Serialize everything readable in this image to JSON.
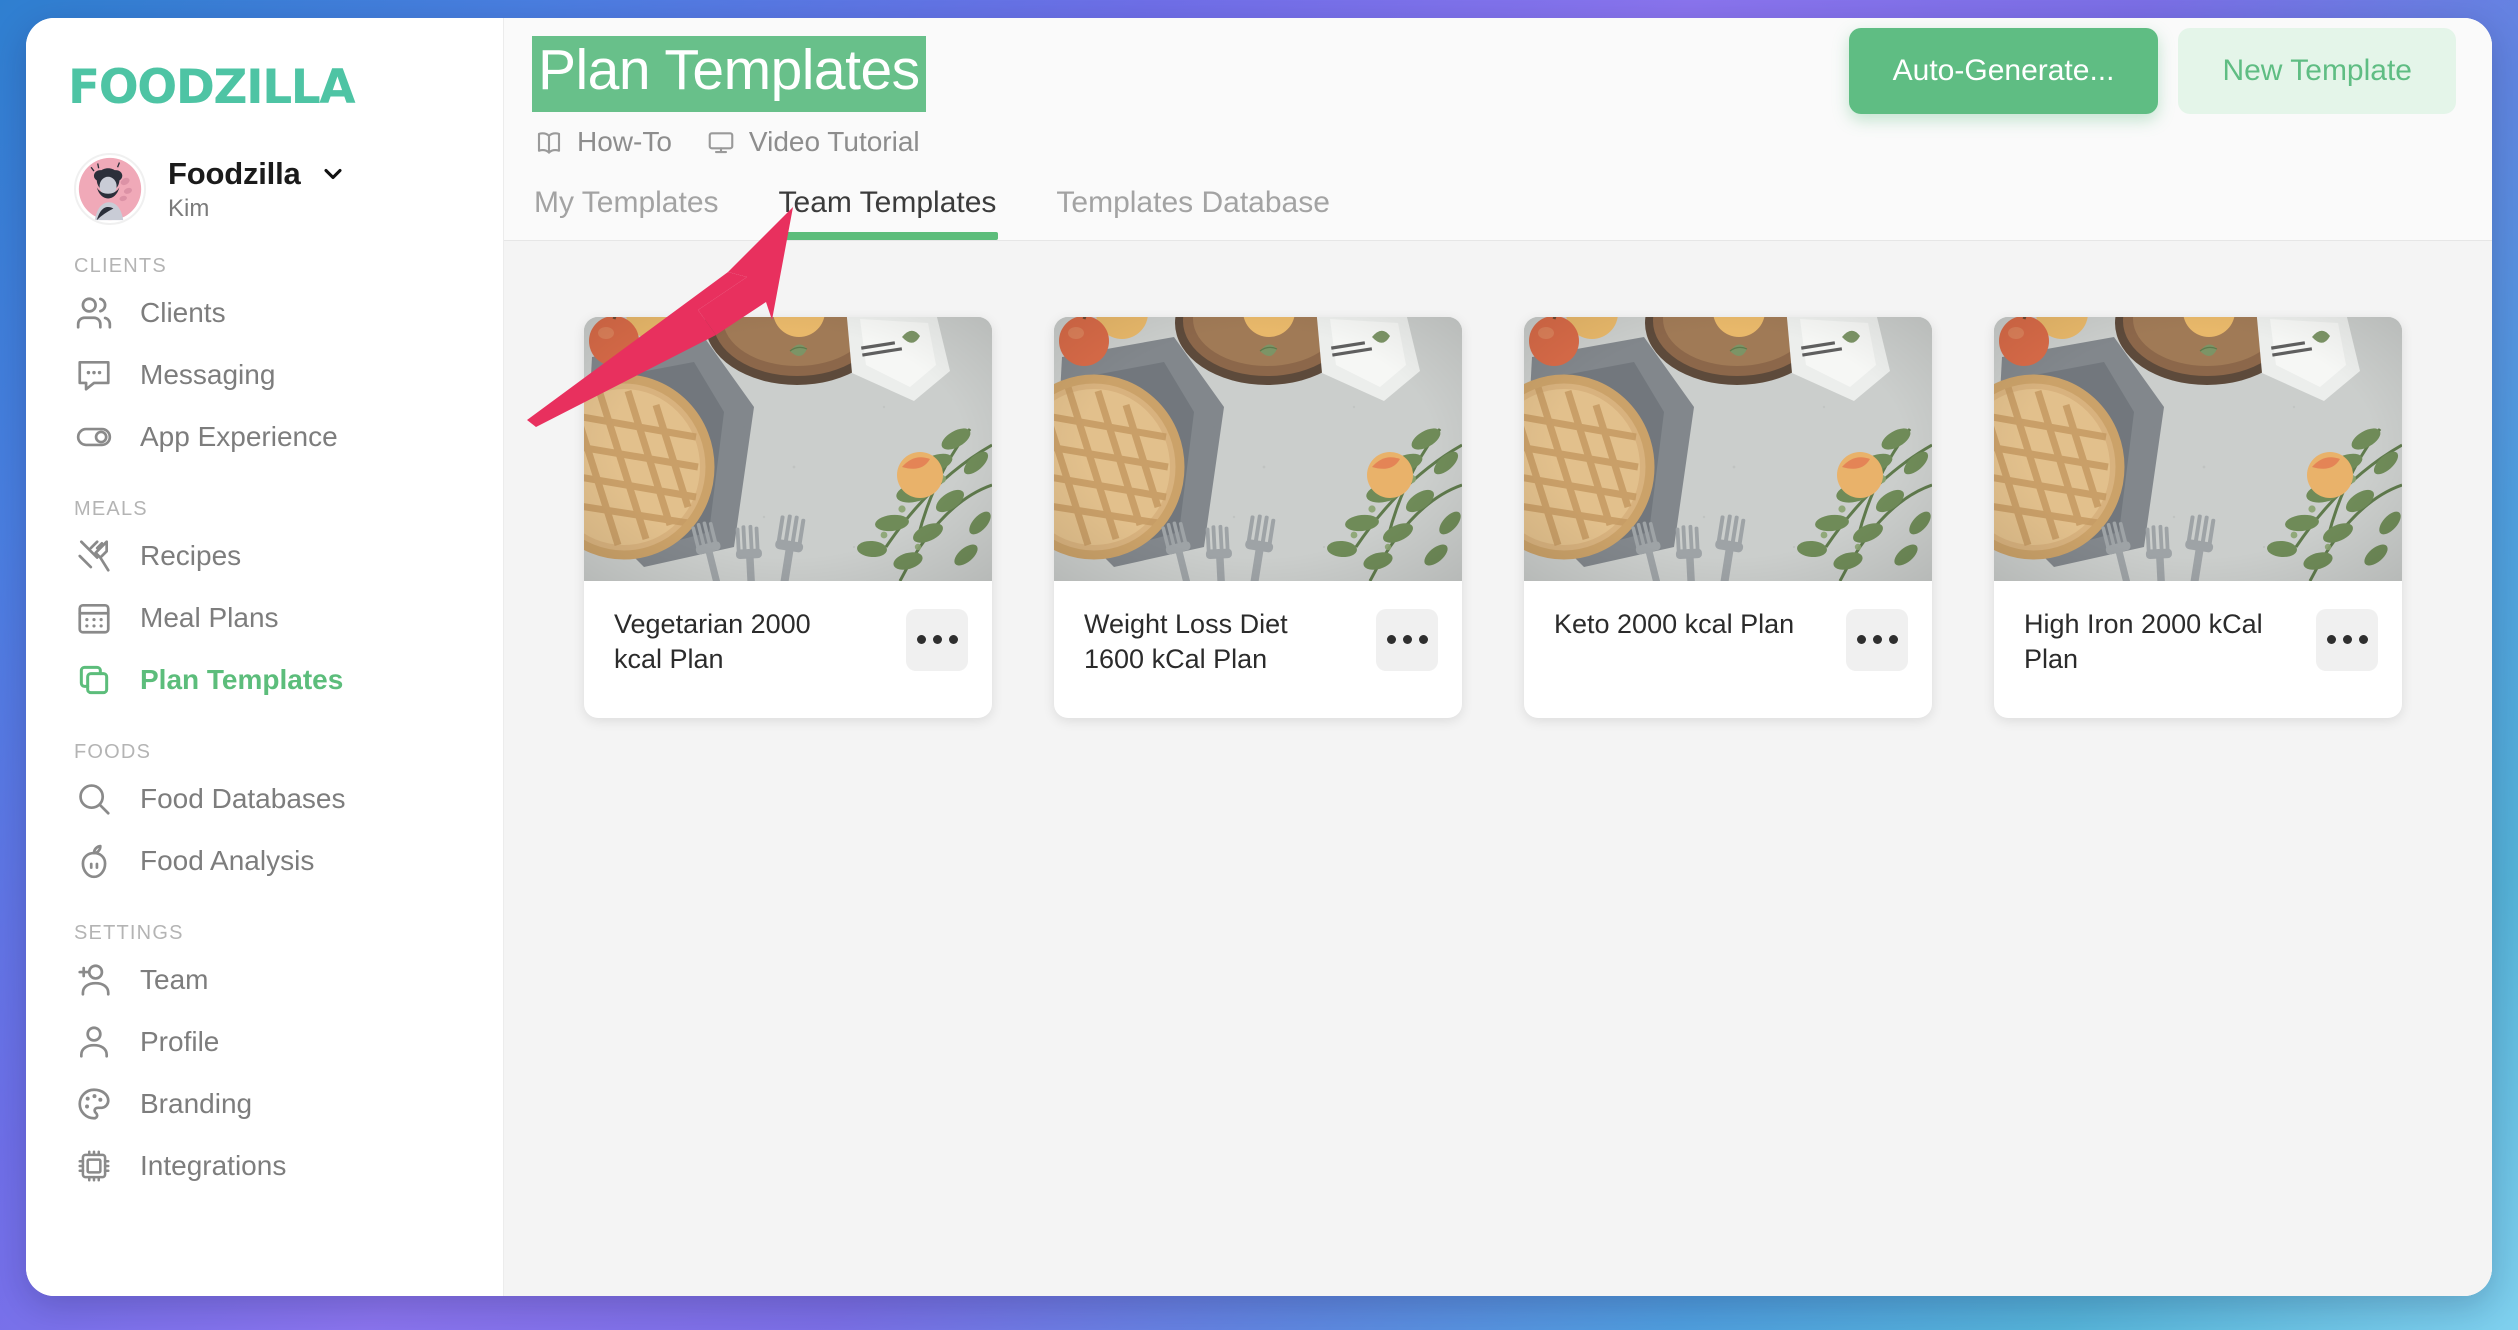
{
  "app": {
    "brand": "FOODZILLA",
    "accent_green": "#5cbd7b",
    "brand_teal": "#4ec4a4",
    "annotation_color": "#e8305e"
  },
  "sidebar": {
    "account": {
      "name": "Foodzilla",
      "sub": "Kim",
      "avatar_icon": "user-avatar-illustration",
      "chevron_icon": "chevron-down-icon"
    },
    "sections": [
      {
        "label": "CLIENTS",
        "items": [
          {
            "label": "Clients",
            "icon": "people-icon",
            "active": false
          },
          {
            "label": "Messaging",
            "icon": "chat-bubble-icon",
            "active": false
          },
          {
            "label": "App Experience",
            "icon": "toggle-icon",
            "active": false
          }
        ]
      },
      {
        "label": "MEALS",
        "items": [
          {
            "label": "Recipes",
            "icon": "fork-knife-icon",
            "active": false
          },
          {
            "label": "Meal Plans",
            "icon": "calendar-icon",
            "active": false
          },
          {
            "label": "Plan Templates",
            "icon": "copy-icon",
            "active": true
          }
        ]
      },
      {
        "label": "FOODS",
        "items": [
          {
            "label": "Food Databases",
            "icon": "search-icon",
            "active": false
          },
          {
            "label": "Food Analysis",
            "icon": "apple-icon",
            "active": false
          }
        ]
      },
      {
        "label": "SETTINGS",
        "items": [
          {
            "label": "Team",
            "icon": "user-plus-icon",
            "active": false
          },
          {
            "label": "Profile",
            "icon": "user-icon",
            "active": false
          },
          {
            "label": "Branding",
            "icon": "palette-icon",
            "active": false
          },
          {
            "label": "Integrations",
            "icon": "chip-icon",
            "active": false
          }
        ]
      }
    ]
  },
  "header": {
    "title": "Plan Templates",
    "helper_links": [
      {
        "label": "How-To",
        "icon": "book-icon"
      },
      {
        "label": "Video Tutorial",
        "icon": "monitor-icon"
      }
    ],
    "actions": {
      "primary_label": "Auto-Generate...",
      "ghost_label": "New Template"
    },
    "tabs": [
      {
        "label": "My Templates",
        "active": false
      },
      {
        "label": "Team Templates",
        "active": true
      },
      {
        "label": "Templates Database",
        "active": false
      }
    ]
  },
  "content": {
    "cards": [
      {
        "title": "Vegetarian 2000 kcal Plan",
        "menu_icon": "ellipsis-icon",
        "thumb": "food-flatlay-photo"
      },
      {
        "title": "Weight Loss Diet 1600 kCal Plan",
        "menu_icon": "ellipsis-icon",
        "thumb": "food-flatlay-photo"
      },
      {
        "title": "Keto 2000 kcal Plan",
        "menu_icon": "ellipsis-icon",
        "thumb": "food-flatlay-photo"
      },
      {
        "title": "High Iron 2000 kCal Plan",
        "menu_icon": "ellipsis-icon",
        "thumb": "food-flatlay-photo"
      }
    ]
  },
  "annotation": {
    "type": "arrow",
    "points_to": "Team Templates",
    "color": "#e8305e"
  }
}
